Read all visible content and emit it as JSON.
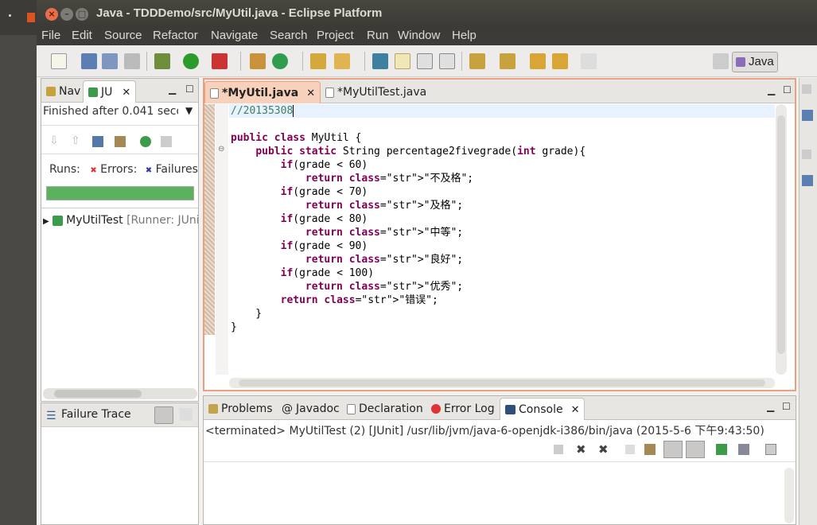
{
  "window": {
    "title": "Java - TDDDemo/src/MyUtil.java - Eclipse Platform",
    "controls": [
      "close",
      "minimize",
      "maximize"
    ]
  },
  "menu": [
    "File",
    "Edit",
    "Source",
    "Refactor",
    "Navigate",
    "Search",
    "Project",
    "Run",
    "Window",
    "Help"
  ],
  "perspective": {
    "label": "Java"
  },
  "left_panel": {
    "tabs": [
      {
        "label": "Nav"
      },
      {
        "label": "JU"
      }
    ],
    "status": "Finished after 0.041 secon",
    "runs_label": "Runs:",
    "errors_label": "Errors:",
    "failures_label": "Failures",
    "progress": 1.0,
    "progress_color": "#5bb25d",
    "tree_item": "MyUtilTest",
    "tree_item_runner": "[Runner: JUni"
  },
  "failure_trace": {
    "label": "Failure Trace"
  },
  "editor": {
    "tabs": [
      {
        "label": "*MyUtil.java",
        "active": true
      },
      {
        "label": "*MyUtilTest.java",
        "active": false
      }
    ],
    "lines": [
      "//20135308",
      "",
      "public class MyUtil {",
      "    public static String percentage2fivegrade(int grade){",
      "        if(grade < 60)",
      "            return \"不及格\";",
      "        if(grade < 70)",
      "            return \"及格\";",
      "        if(grade < 80)",
      "            return \"中等\";",
      "        if(grade < 90)",
      "            return \"良好\";",
      "        if(grade < 100)",
      "            return \"优秀\";",
      "        return \"错误\";",
      "    }",
      "}"
    ]
  },
  "bottom_panel": {
    "tabs": [
      {
        "label": "Problems"
      },
      {
        "label": "Javadoc"
      },
      {
        "label": "Declaration"
      },
      {
        "label": "Error Log"
      },
      {
        "label": "Console",
        "active": true
      }
    ],
    "console_status": "<terminated> MyUtilTest (2) [JUnit] /usr/lib/jvm/java-6-openjdk-i386/bin/java (2015-5-6 下午9:43:50)"
  }
}
